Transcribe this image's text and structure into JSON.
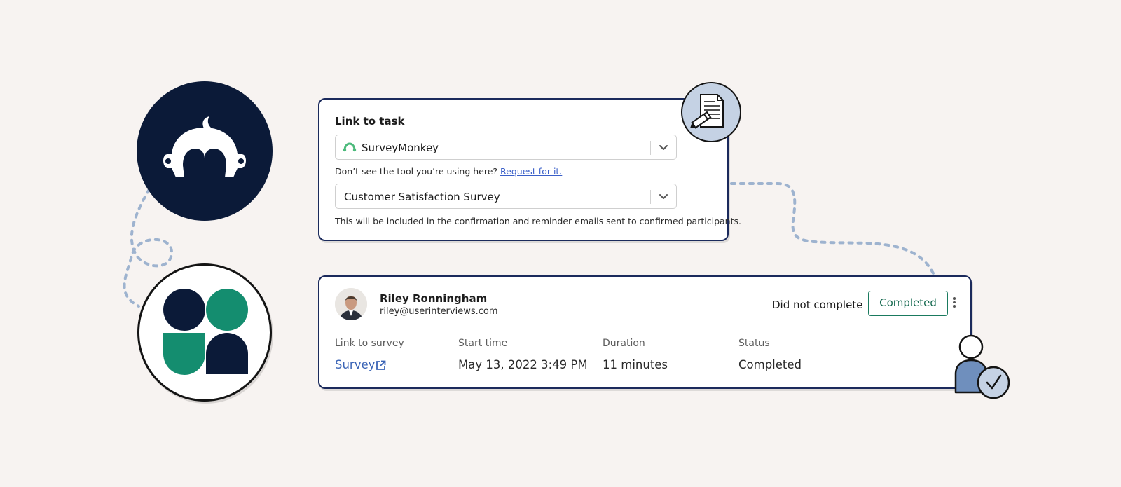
{
  "task_card": {
    "title": "Link to task",
    "tool_select": {
      "value": "SurveyMonkey",
      "icon": "surveymonkey-icon"
    },
    "tool_helper_text": "Don’t see the tool you’re using here?",
    "tool_helper_link": "Request for it.",
    "survey_select": {
      "value": "Customer Satisfaction Survey"
    },
    "survey_helper_text": "This will be included in the confirmation and reminder emails sent to confirmed participants."
  },
  "participant_card": {
    "name": "Riley Ronningham",
    "email": "riley@userinterviews.com",
    "not_complete_label": "Did not complete",
    "completed_label": "Completed",
    "columns": {
      "link_label": "Link to survey",
      "link_value": "Survey",
      "start_label": "Start time",
      "start_value": "May 13, 2022 3:49 PM",
      "duration_label": "Duration",
      "duration_value": "11 minutes",
      "status_label": "Status",
      "status_value": "Completed"
    }
  },
  "colors": {
    "background": "#f7f3f1",
    "navy": "#0b1a38",
    "green": "#148d6f",
    "card_border": "#1b2a5c",
    "link": "#3a64b6",
    "badge": "#c5d2e4"
  }
}
